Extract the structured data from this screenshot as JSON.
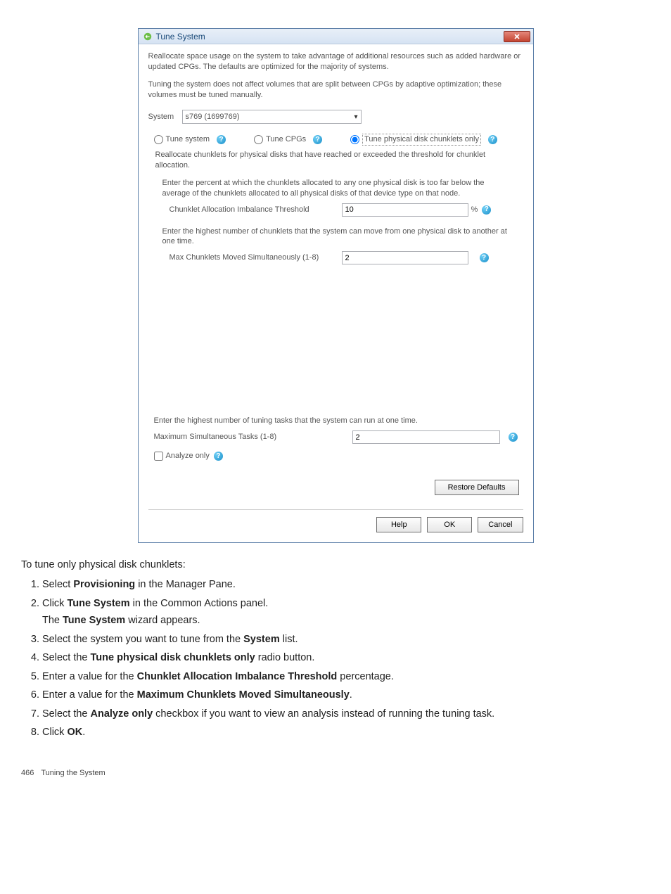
{
  "dialog": {
    "title": "Tune System",
    "intro1": "Reallocate space usage on the system to take advantage of additional resources such as added hardware or updated CPGs. The defaults are optimized for the majority of systems.",
    "intro2": "Tuning the system does not affect volumes that are split between CPGs by adaptive optimization; these volumes must be tuned manually.",
    "system_label": "System",
    "system_value": "s769 (1699769)",
    "radios": {
      "tune_system": "Tune system",
      "tune_cpgs": "Tune CPGs",
      "tune_pd": "Tune physical disk chunklets only"
    },
    "radio_desc": "Reallocate chunklets for physical disks that have reached or exceeded the threshold for chunklet allocation.",
    "threshold_intro": "Enter the percent at which the chunklets allocated to any one physical disk is too far below the average of the chunklets allocated to all physical disks of that device type on that node.",
    "threshold_label": "Chunklet Allocation Imbalance Threshold",
    "threshold_value": "10",
    "pct": "%",
    "maxmove_intro": "Enter the highest number of chunklets that the system can move from one physical disk to another at one time.",
    "maxmove_label": "Max Chunklets Moved Simultaneously  (1-8)",
    "maxmove_value": "2",
    "maxtasks_intro": "Enter the highest number of tuning tasks that the system can run at one time.",
    "maxtasks_label": "Maximum Simultaneous Tasks  (1-8)",
    "maxtasks_value": "2",
    "analyze_label": "Analyze only",
    "restore_label": "Restore Defaults",
    "help": "Help",
    "ok": "OK",
    "cancel": "Cancel"
  },
  "doc": {
    "lead": "To tune only physical disk chunklets:",
    "step1_a": "Select ",
    "step1_b": "Provisioning",
    "step1_c": " in the Manager Pane.",
    "step2_a": "Click ",
    "step2_b": "Tune System",
    "step2_c": " in the Common Actions panel.",
    "step2_sub_a": "The ",
    "step2_sub_b": "Tune System",
    "step2_sub_c": " wizard appears.",
    "step3_a": "Select the system you want to tune from the ",
    "step3_b": "System",
    "step3_c": " list.",
    "step4_a": "Select the ",
    "step4_b": "Tune physical disk chunklets only",
    "step4_c": " radio button.",
    "step5_a": "Enter a value for the ",
    "step5_b": "Chunklet Allocation Imbalance Threshold",
    "step5_c": " percentage.",
    "step6_a": "Enter a value for the ",
    "step6_b": "Maximum Chunklets Moved Simultaneously",
    "step6_c": ".",
    "step7_a": "Select the ",
    "step7_b": "Analyze only",
    "step7_c": " checkbox if you want to view an analysis instead of running the tuning task.",
    "step8_a": "Click ",
    "step8_b": "OK",
    "step8_c": "."
  },
  "footer": {
    "page": "466",
    "section": "Tuning the System"
  }
}
